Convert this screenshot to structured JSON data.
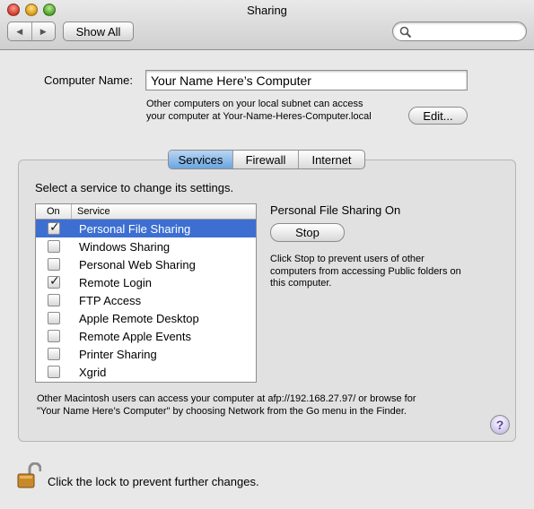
{
  "window": {
    "title": "Sharing"
  },
  "toolbar": {
    "show_all_label": "Show All",
    "back_label": "◀",
    "forward_label": "▶"
  },
  "computer_name": {
    "label": "Computer Name:",
    "value": "Your Name Here’s Computer",
    "help_line1": "Other computers on your local subnet can access",
    "help_line2": "your computer at Your-Name-Heres-Computer.local",
    "edit_label": "Edit..."
  },
  "tabs": [
    {
      "label": "Services",
      "active": true
    },
    {
      "label": "Firewall",
      "active": false
    },
    {
      "label": "Internet",
      "active": false
    }
  ],
  "services": {
    "select_prompt": "Select a service to change its settings.",
    "column_on": "On",
    "column_service": "Service",
    "items": [
      {
        "label": "Personal File Sharing",
        "checked": true,
        "selected": true
      },
      {
        "label": "Windows Sharing",
        "checked": false,
        "selected": false
      },
      {
        "label": "Personal Web Sharing",
        "checked": false,
        "selected": false
      },
      {
        "label": "Remote Login",
        "checked": true,
        "selected": false
      },
      {
        "label": "FTP Access",
        "checked": false,
        "selected": false
      },
      {
        "label": "Apple Remote Desktop",
        "checked": false,
        "selected": false
      },
      {
        "label": "Remote Apple Events",
        "checked": false,
        "selected": false
      },
      {
        "label": "Printer Sharing",
        "checked": false,
        "selected": false
      },
      {
        "label": "Xgrid",
        "checked": false,
        "selected": false
      }
    ]
  },
  "status": {
    "title": "Personal File Sharing On",
    "stop_label": "Stop",
    "help_line1": "Click Stop to prevent users of other",
    "help_line2": "computers from accessing Public folders on",
    "help_line3": "this computer."
  },
  "afp_note": {
    "line1": "Other Macintosh users can access your computer at afp://192.168.27.97/ or browse for",
    "line2": "\"Your Name Here’s Computer\" by choosing Network from the Go menu in the Finder."
  },
  "help_label": "?",
  "lock": {
    "text": "Click the lock to prevent further changes."
  },
  "colors": {
    "selection": "#3d6fd2",
    "tab_active": "#6aa5e0"
  }
}
